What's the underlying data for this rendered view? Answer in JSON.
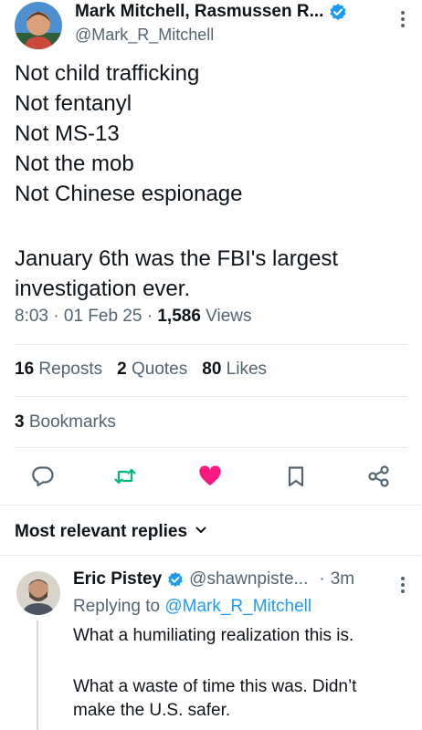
{
  "tweet": {
    "author_name": "Mark Mitchell, Rasmussen R...",
    "author_handle": "@Mark_R_Mitchell",
    "lines": [
      "Not child trafficking",
      "Not fentanyl",
      "Not MS-13",
      "Not the mob",
      "Not Chinese espionage"
    ],
    "lines2": [
      "January 6th was the FBI's largest",
      "investigation ever."
    ],
    "time": "8:03",
    "date": "01 Feb 25",
    "views_count": "1,586",
    "views_label": "Views",
    "reposts_count": "16",
    "reposts_label": "Reposts",
    "quotes_count": "2",
    "quotes_label": "Quotes",
    "likes_count": "80",
    "likes_label": "Likes",
    "bookmarks_count": "3",
    "bookmarks_label": "Bookmarks",
    "liked": true,
    "accent": "#1d9bf0",
    "like_color": "#f91880",
    "repost_color": "#00ba7c"
  },
  "replies_section": {
    "header": "Most relevant replies"
  },
  "reply": {
    "name": "Eric Pistey",
    "handle": "@shawnpiste...",
    "time": "3m",
    "replying_prefix": "Replying to",
    "replying_to": "@Mark_R_Mitchell",
    "text1": "What a humiliating realization this is.",
    "text2": "What a waste of time this was. Didn’t",
    "text3": "make the U.S. safer."
  },
  "icons": [
    "verified-badge-icon",
    "more-options-icon",
    "reply-icon",
    "repost-icon",
    "like-icon",
    "bookmark-icon",
    "share-icon",
    "chevron-down-icon"
  ]
}
